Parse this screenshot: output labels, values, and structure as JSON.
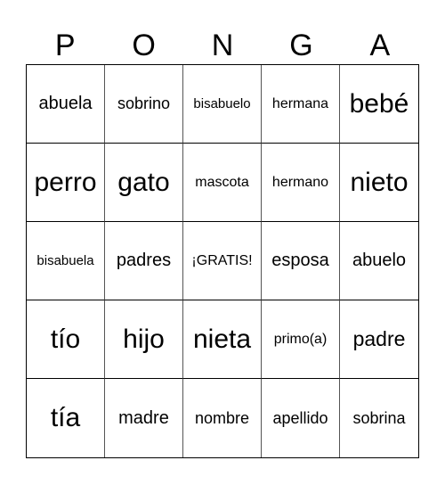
{
  "header": [
    "P",
    "O",
    "N",
    "G",
    "A"
  ],
  "cells": [
    [
      "abuela",
      "sobrino",
      "bisabuelo",
      "hermana",
      "bebé"
    ],
    [
      "perro",
      "gato",
      "mascota",
      "hermano",
      "nieto"
    ],
    [
      "bisabuela",
      "padres",
      "¡GRATIS!",
      "esposa",
      "abuelo"
    ],
    [
      "tío",
      "hijo",
      "nieta",
      "primo(a)",
      "padre"
    ],
    [
      "tía",
      "madre",
      "nombre",
      "apellido",
      "sobrina"
    ]
  ]
}
